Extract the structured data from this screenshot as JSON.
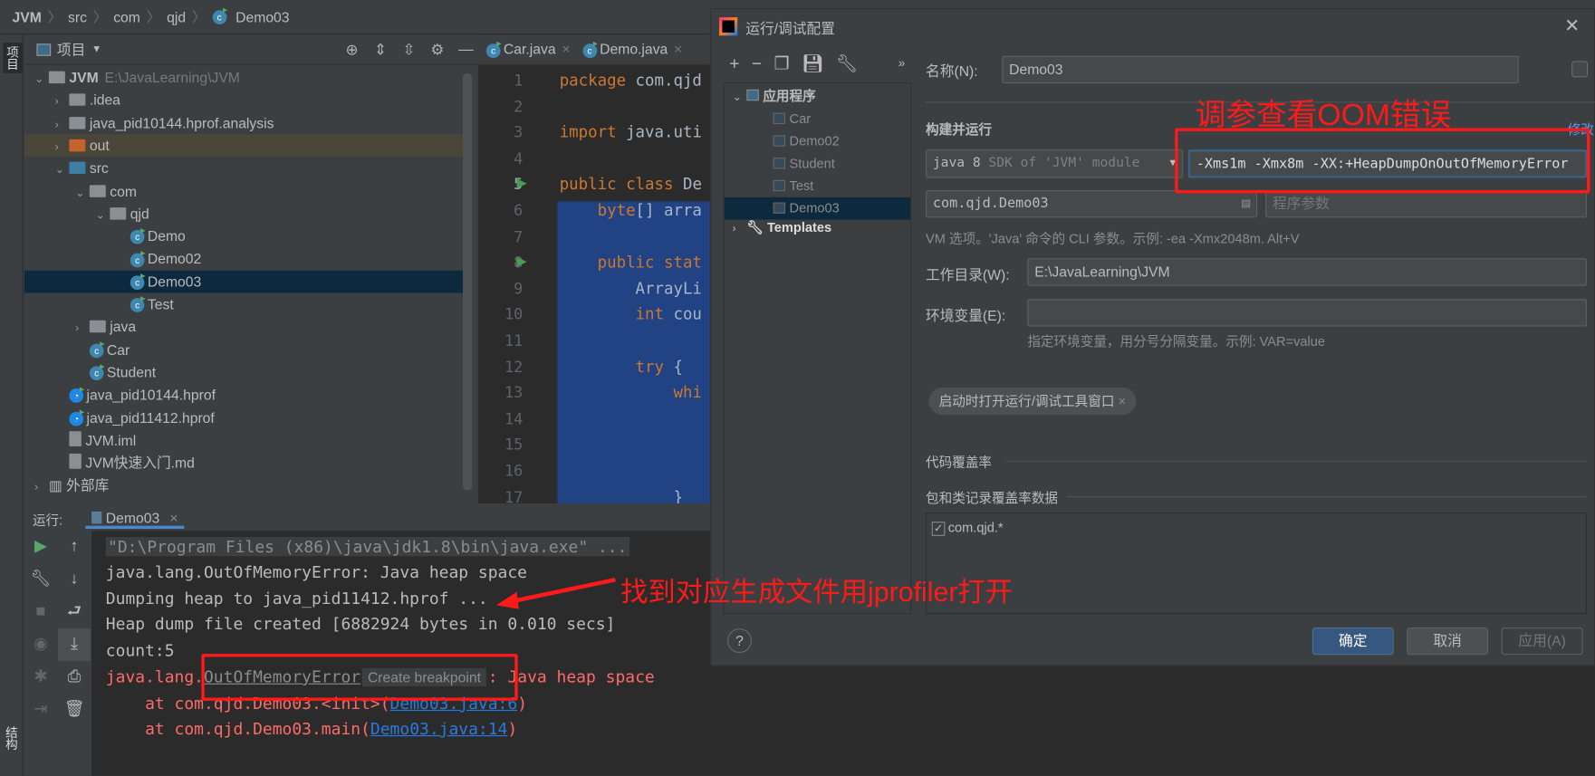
{
  "breadcrumb": [
    "JVM",
    "src",
    "com",
    "qjd",
    "Demo03"
  ],
  "left_strip": {
    "project_tab": "项目",
    "structure_tab": "结构"
  },
  "project": {
    "title": "项目",
    "tree": [
      {
        "label": "JVM",
        "extra": "E:\\JavaLearning\\JVM",
        "depth": 0,
        "type": "module",
        "open": true
      },
      {
        "label": ".idea",
        "depth": 1,
        "type": "folder"
      },
      {
        "label": "java_pid10144.hprof.analysis",
        "depth": 1,
        "type": "folder"
      },
      {
        "label": "out",
        "depth": 1,
        "type": "folder-out"
      },
      {
        "label": "src",
        "depth": 1,
        "type": "folder-src",
        "open": true
      },
      {
        "label": "com",
        "depth": 2,
        "type": "package",
        "open": true
      },
      {
        "label": "qjd",
        "depth": 3,
        "type": "package",
        "open": true
      },
      {
        "label": "Demo",
        "depth": 4,
        "type": "class"
      },
      {
        "label": "Demo02",
        "depth": 4,
        "type": "class"
      },
      {
        "label": "Demo03",
        "depth": 4,
        "type": "class",
        "selected": true
      },
      {
        "label": "Test",
        "depth": 4,
        "type": "class"
      },
      {
        "label": "java",
        "depth": 2,
        "type": "package"
      },
      {
        "label": "Car",
        "depth": 2,
        "type": "class"
      },
      {
        "label": "Student",
        "depth": 2,
        "type": "class"
      },
      {
        "label": "java_pid10144.hprof",
        "depth": 1,
        "type": "hprof"
      },
      {
        "label": "java_pid11412.hprof",
        "depth": 1,
        "type": "hprof"
      },
      {
        "label": "JVM.iml",
        "depth": 1,
        "type": "file"
      },
      {
        "label": "JVM快速入门.md",
        "depth": 1,
        "type": "md"
      },
      {
        "label": "外部库",
        "depth": 0,
        "type": "lib"
      }
    ]
  },
  "editor": {
    "tabs": [
      "Car.java",
      "Demo.java"
    ],
    "lines": [
      {
        "n": "1",
        "parts": [
          [
            "kw",
            "package "
          ],
          [
            "",
            "com.qjd"
          ]
        ]
      },
      {
        "n": "2",
        "parts": []
      },
      {
        "n": "3",
        "parts": [
          [
            "kw",
            "import "
          ],
          [
            "",
            "java.uti"
          ]
        ]
      },
      {
        "n": "4",
        "parts": []
      },
      {
        "n": "5",
        "parts": [
          [
            "kw",
            "public class "
          ],
          [
            "",
            "De"
          ]
        ]
      },
      {
        "n": "6",
        "parts": [
          [
            "",
            "    "
          ],
          [
            "kw",
            "byte"
          ],
          [
            "",
            "[] arra"
          ]
        ]
      },
      {
        "n": "7",
        "parts": []
      },
      {
        "n": "8",
        "parts": [
          [
            "",
            "    "
          ],
          [
            "kw",
            "public stat"
          ]
        ]
      },
      {
        "n": "9",
        "parts": [
          [
            "",
            "        ArrayLi"
          ]
        ]
      },
      {
        "n": "10",
        "parts": [
          [
            "",
            "        "
          ],
          [
            "kw",
            "int "
          ],
          [
            "",
            "cou"
          ]
        ]
      },
      {
        "n": "11",
        "parts": []
      },
      {
        "n": "12",
        "parts": [
          [
            "",
            "        "
          ],
          [
            "kw",
            "try "
          ],
          [
            "",
            "{"
          ]
        ]
      },
      {
        "n": "13",
        "parts": [
          [
            "",
            "            "
          ],
          [
            "kw",
            "whi"
          ]
        ]
      },
      {
        "n": "14",
        "parts": []
      },
      {
        "n": "15",
        "parts": []
      },
      {
        "n": "16",
        "parts": []
      },
      {
        "n": "17",
        "parts": [
          [
            "",
            "            }"
          ]
        ]
      }
    ]
  },
  "run": {
    "label": "运行:",
    "tab": "Demo03",
    "console": {
      "cmd": "\"D:\\Program Files (x86)\\java\\jdk1.8\\bin\\java.exe\" ...",
      "l1": "java.lang.OutOfMemoryError: Java heap space",
      "l2": "Dumping heap to java_pid11412.hprof ...",
      "l3": "Heap dump file created [6882924 bytes in 0.010 secs]",
      "l4": "count:5",
      "e_prefix": "java.lang.",
      "e_class": "OutOfMemoryError",
      "e_tooltip": "Create breakpoint",
      "e_suffix": ": Java heap space",
      "at1_prefix": "    at com.qjd.Demo03.<init>(",
      "at1_link": "Demo03.java:6",
      "at2_prefix": "    at com.qjd.Demo03.main(",
      "at2_link": "Demo03.java:14",
      "close_paren": ")"
    }
  },
  "dialog": {
    "title": "运行/调试配置",
    "tree": {
      "group": "应用程序",
      "items": [
        "Car",
        "Demo02",
        "Student",
        "Test",
        "Demo03"
      ],
      "selected": "Demo03",
      "templates": "Templates"
    },
    "name_label": "名称(N):",
    "name_value": "Demo03",
    "section_build": "构建并运行",
    "modify": "修改",
    "sdk": "java 8",
    "sdk_detail": "SDK of 'JVM' module",
    "vm_options": "-Xms1m -Xmx8m -XX:+HeapDumpOnOutOfMemoryError",
    "main_class": "com.qjd.Demo03",
    "program_args_placeholder": "程序参数",
    "vm_hint": "VM 选项。'Java' 命令的 CLI 参数。示例: -ea -Xmx2048m. Alt+V",
    "workdir_label": "工作目录(W):",
    "workdir_value": "E:\\JavaLearning\\JVM",
    "env_label": "环境变量(E):",
    "env_value": "",
    "env_hint": "指定环境变量，用分号分隔变量。示例: VAR=value",
    "chip": "启动时打开运行/调试工具窗口",
    "coverage": "代码覆盖率",
    "coverage_pkgs": "包和类记录覆盖率数据",
    "coverage_item": "com.qjd.*",
    "ok": "确定",
    "cancel": "取消",
    "apply": "应用(A)"
  },
  "annotations": {
    "vm": "调参查看OOM错误",
    "file": "找到对应生成文件用jprofiler打开",
    "color": "#ff1a1a"
  }
}
